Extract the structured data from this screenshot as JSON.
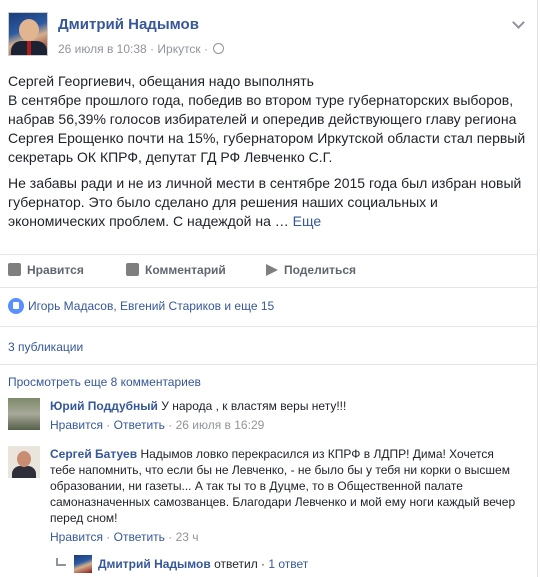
{
  "post": {
    "author": "Дмитрий Надымов",
    "date": "26 июля в 10:38",
    "dot": "·",
    "location": "Иркутск",
    "paragraphs": [
      "Сергей Георгиевич, обещания надо выполнять\nВ сентябре прошлого года, победив во втором туре губернаторских выборов, набрав 56,39% голосов избирателей и опередив действующего главу региона Сергея Ерощенко почти на 15%, губернатором Иркутской области стал первый секретарь ОК КПРФ, депутат ГД РФ Левченко С.Г.",
      "Не забавы ради и не из личной мести в сентябре 2015 года был избран новый губернатор. Это было сделано для решения наших социальных и экономических проблем. С надеждой на …"
    ],
    "more_link": "Еще"
  },
  "actions": {
    "like": "Нравится",
    "comment": "Комментарий",
    "share": "Поделиться"
  },
  "likers": "Игорь Мадасов, Евгений Стариков и еще 15",
  "shares": "3 публикации",
  "more_comments": "Просмотреть еще 8 комментариев",
  "comments": [
    {
      "author": "Юрий Поддубный",
      "text": "У народа , к властям веры нету!!!",
      "like": "Нравится",
      "reply": "Ответить",
      "time": "26 июля в 16:29"
    },
    {
      "author": "Сергей Батуев",
      "text": "Надымов ловко перекрасился из КПРФ в ЛДПР! Дима! Хочется тебе напомнить, что если бы не Левченко, - не было бы у тебя ни корки о высшем образовании, ни газеты... А так ты то в Дуцме, то в Общественной палате самоназначенных самозванцев. Благодари Левченко и мой ему ноги каждый вечер перед сном!",
      "like": "Нравится",
      "reply": "Ответить",
      "time": "23 ч"
    }
  ],
  "reply_row": {
    "name": "Дмитрий Надымов",
    "verb": "ответил",
    "count": "1 ответ"
  }
}
